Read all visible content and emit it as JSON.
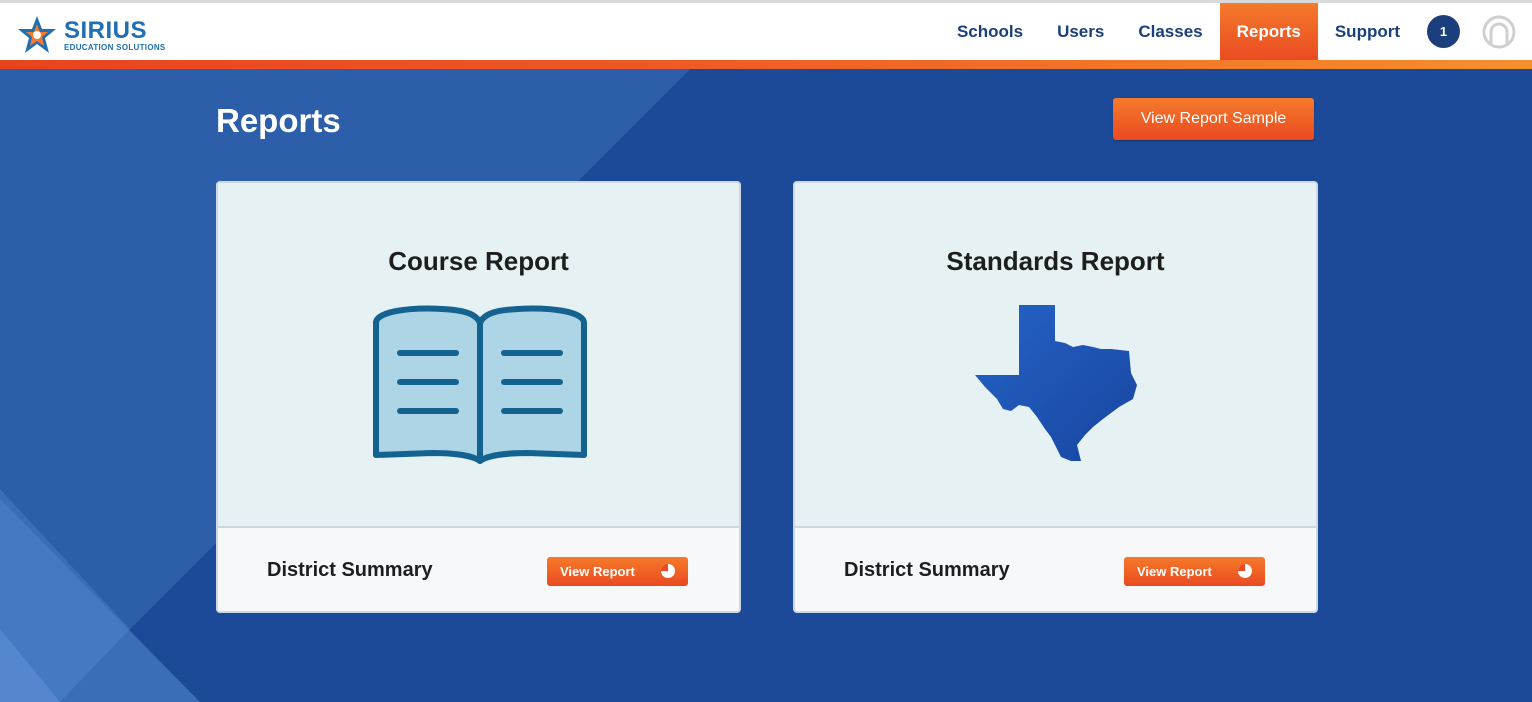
{
  "brand": {
    "name": "SIRIUS",
    "tagline": "EDUCATION SOLUTIONS"
  },
  "nav": {
    "items": [
      {
        "label": "Schools"
      },
      {
        "label": "Users"
      },
      {
        "label": "Classes"
      },
      {
        "label": "Reports",
        "active": true
      },
      {
        "label": "Support"
      }
    ],
    "notification_count": "1"
  },
  "page": {
    "title": "Reports",
    "sample_button": "View Report Sample"
  },
  "cards": [
    {
      "title": "Course Report",
      "icon": "open-book-icon",
      "summary": "District Summary",
      "button": "View Report",
      "button_icon": "pie-chart-icon"
    },
    {
      "title": "Standards Report",
      "icon": "texas-map-icon",
      "summary": "District Summary",
      "button": "View Report",
      "button_icon": "pie-chart-icon"
    }
  ],
  "colors": {
    "background": "#1c4a98",
    "accent": "#ea4a21",
    "nav_text": "#1b3f7c"
  }
}
